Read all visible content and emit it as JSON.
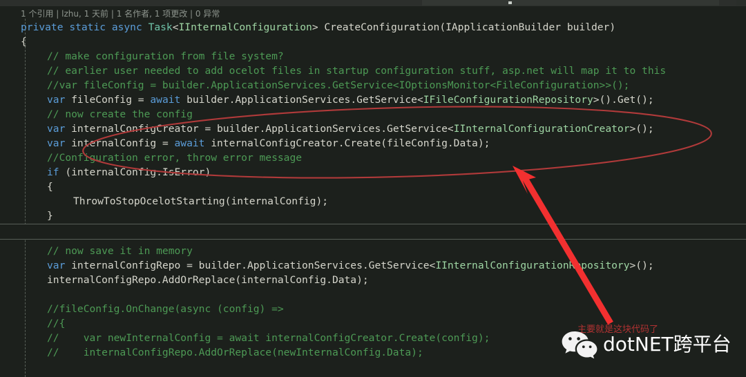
{
  "editor": {
    "theme_background": "#1c201c",
    "codelens": "1 个引用 | lzhu, 1 天前 | 1 名作者, 1 项更改 | 0 异常",
    "lines": [
      {
        "indent": 0,
        "tokens": [
          {
            "t": "private",
            "c": "kw"
          },
          {
            "t": " ",
            "c": "plain"
          },
          {
            "t": "static",
            "c": "kw"
          },
          {
            "t": " ",
            "c": "plain"
          },
          {
            "t": "async",
            "c": "kw"
          },
          {
            "t": " ",
            "c": "plain"
          },
          {
            "t": "Task",
            "c": "cls"
          },
          {
            "t": "<",
            "c": "punc"
          },
          {
            "t": "IInternalConfiguration",
            "c": "type"
          },
          {
            "t": "> CreateConfiguration(IApplicationBuilder builder)",
            "c": "plain"
          }
        ]
      },
      {
        "indent": 0,
        "tokens": [
          {
            "t": "{",
            "c": "plain"
          }
        ]
      },
      {
        "indent": 1,
        "tokens": [
          {
            "t": "// make configuration from file system?",
            "c": "cmt"
          }
        ]
      },
      {
        "indent": 1,
        "tokens": [
          {
            "t": "// earlier user needed to add ocelot files in startup configuration stuff, asp.net will map it to this",
            "c": "cmt"
          }
        ]
      },
      {
        "indent": 1,
        "tokens": [
          {
            "t": "//var fileConfig = builder.ApplicationServices.GetService<IOptionsMonitor<FileConfiguration>>();",
            "c": "cmt"
          }
        ]
      },
      {
        "indent": 1,
        "tokens": [
          {
            "t": "var",
            "c": "kw"
          },
          {
            "t": " fileConfig = ",
            "c": "plain"
          },
          {
            "t": "await",
            "c": "kw"
          },
          {
            "t": " builder.ApplicationServices.GetService<",
            "c": "plain"
          },
          {
            "t": "IFileConfigurationRepository",
            "c": "type"
          },
          {
            "t": ">().Get();",
            "c": "plain"
          }
        ]
      },
      {
        "indent": 1,
        "tokens": [
          {
            "t": "// now create the config",
            "c": "cmt"
          }
        ]
      },
      {
        "indent": 1,
        "tokens": [
          {
            "t": "var",
            "c": "kw"
          },
          {
            "t": " internalConfigCreator = builder.ApplicationServices.GetService<",
            "c": "plain"
          },
          {
            "t": "IInternalConfigurationCreator",
            "c": "type"
          },
          {
            "t": ">();",
            "c": "plain"
          }
        ]
      },
      {
        "indent": 1,
        "tokens": [
          {
            "t": "var",
            "c": "kw"
          },
          {
            "t": " internalConfig = ",
            "c": "plain"
          },
          {
            "t": "await",
            "c": "kw"
          },
          {
            "t": " internalConfigCreator.Create(fileConfig.Data);",
            "c": "plain"
          }
        ]
      },
      {
        "indent": 1,
        "tokens": [
          {
            "t": "//Configuration error, throw error message",
            "c": "cmt"
          }
        ]
      },
      {
        "indent": 1,
        "tokens": [
          {
            "t": "if",
            "c": "kw"
          },
          {
            "t": " (internalConfig.IsError)",
            "c": "plain"
          }
        ]
      },
      {
        "indent": 1,
        "tokens": [
          {
            "t": "{",
            "c": "plain"
          }
        ]
      },
      {
        "indent": 2,
        "tokens": [
          {
            "t": "ThrowToStopOcelotStarting(internalConfig);",
            "c": "plain"
          }
        ]
      },
      {
        "indent": 1,
        "tokens": [
          {
            "t": "}",
            "c": "plain"
          }
        ]
      }
    ],
    "lines_after_fold": [
      {
        "indent": 1,
        "tokens": [
          {
            "t": "// now save it in memory",
            "c": "cmt"
          }
        ]
      },
      {
        "indent": 1,
        "tokens": [
          {
            "t": "var",
            "c": "kw"
          },
          {
            "t": " internalConfigRepo = builder.ApplicationServices.GetService<",
            "c": "plain"
          },
          {
            "t": "IInternalConfigurationRepository",
            "c": "type"
          },
          {
            "t": ">();",
            "c": "plain"
          }
        ]
      },
      {
        "indent": 1,
        "tokens": [
          {
            "t": "internalConfigRepo.AddOrReplace(internalConfig.Data);",
            "c": "plain"
          }
        ]
      },
      {
        "indent": 1,
        "tokens": [
          {
            "t": "",
            "c": "plain"
          }
        ]
      },
      {
        "indent": 1,
        "tokens": [
          {
            "t": "//fileConfig.OnChange(async (config) =>",
            "c": "cmt"
          }
        ]
      },
      {
        "indent": 1,
        "tokens": [
          {
            "t": "//{",
            "c": "cmt"
          }
        ]
      },
      {
        "indent": 1,
        "tokens": [
          {
            "t": "//    var newInternalConfig = await internalConfigCreator.Create(config);",
            "c": "cmt"
          }
        ]
      },
      {
        "indent": 1,
        "tokens": [
          {
            "t": "//    internalConfigRepo.AddOrReplace(newInternalConfig.Data);",
            "c": "cmt"
          }
        ]
      }
    ]
  },
  "annotations": {
    "ellipse_color": "#b03a3a",
    "arrow_color": "#f23030",
    "note": "主要就是这块代码了"
  },
  "watermark": {
    "brand": "dotNET跨平台",
    "logo": "wechat-icon"
  }
}
